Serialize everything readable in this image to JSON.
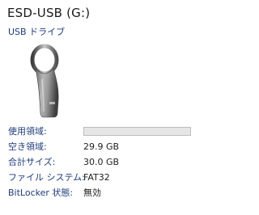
{
  "drive": {
    "title": "ESD-USB (G:)",
    "type": "USB ドライブ",
    "icon": "usb-drive-icon"
  },
  "properties": {
    "used_space_label": "使用領域:",
    "used_fraction": 0.0,
    "free_space_label": "空き領域:",
    "free_space_value": "29.9 GB",
    "capacity_label": "合計サイズ:",
    "capacity_value": "30.0 GB",
    "filesystem_label": "ファイル システム:",
    "filesystem_value": "FAT32",
    "bitlocker_label": "BitLocker 状態:",
    "bitlocker_value": "無効"
  },
  "colors": {
    "label_text": "#1e3a78",
    "bar_track": "#e6e6e6",
    "bar_border": "#bcbcbc",
    "bar_fill": "#26a0da"
  }
}
